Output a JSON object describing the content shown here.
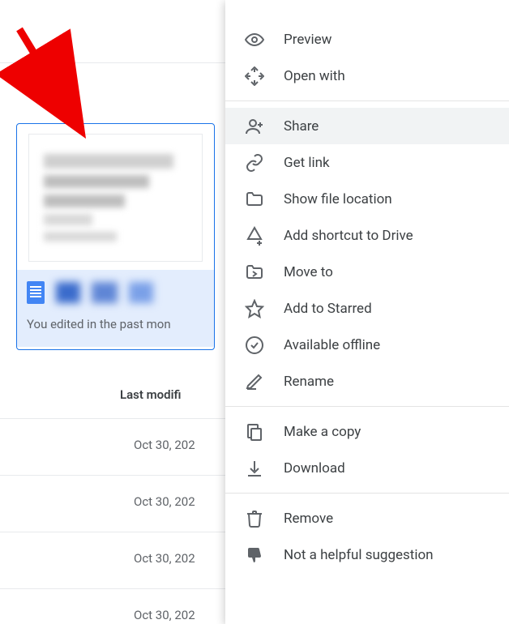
{
  "file_card": {
    "footer_text": "You edited in the past mon"
  },
  "column_header": "Last modifi",
  "dates": [
    "Oct 30, 202",
    "Oct 30, 202",
    "Oct 30, 202",
    "Oct 30, 202"
  ],
  "menu": {
    "preview": "Preview",
    "open_with": "Open with",
    "share": "Share",
    "get_link": "Get link",
    "show_location": "Show file location",
    "add_shortcut": "Add shortcut to Drive",
    "move_to": "Move to",
    "add_starred": "Add to Starred",
    "available_offline": "Available offline",
    "rename": "Rename",
    "make_copy": "Make a copy",
    "download": "Download",
    "remove": "Remove",
    "not_helpful": "Not a helpful suggestion"
  }
}
